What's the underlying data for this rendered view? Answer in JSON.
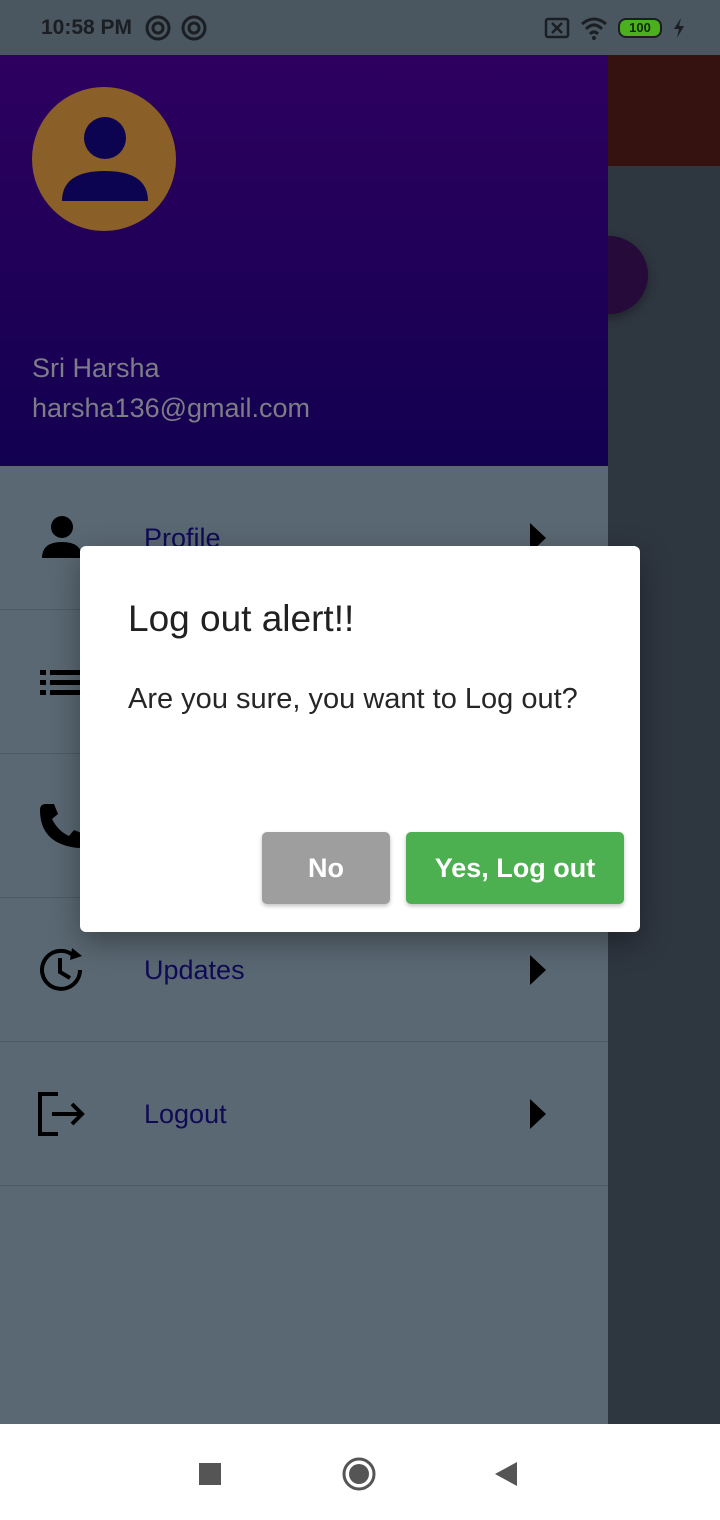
{
  "status_bar": {
    "time": "10:58 PM",
    "battery_level": "100",
    "left_icons": [
      "sync-circle-icon",
      "sync-circle-icon"
    ],
    "right_icons": [
      "no-sim-icon",
      "wifi-icon",
      "battery-icon",
      "charging-icon"
    ]
  },
  "drawer": {
    "user_name": "Sri Harsha",
    "user_email": "harsha136@gmail.com",
    "menu_items": [
      {
        "label": "Profile",
        "icon": "person-icon"
      },
      {
        "label": "",
        "icon": "list-icon"
      },
      {
        "label": "",
        "icon": "phone-icon"
      },
      {
        "label": "Updates",
        "icon": "history-icon"
      },
      {
        "label": "Logout",
        "icon": "logout-icon"
      }
    ]
  },
  "dialog": {
    "title": "Log out alert!!",
    "message": "Are you sure, you want to Log out?",
    "no_label": "No",
    "yes_label": "Yes, Log out"
  },
  "colors": {
    "drawer_header_top": "#2e0060",
    "drawer_header_bottom": "#120050",
    "avatar_bg": "#8a5f28",
    "menu_text": "#0f0a55",
    "no_button": "#9e9e9e",
    "yes_button": "#4caf50"
  }
}
